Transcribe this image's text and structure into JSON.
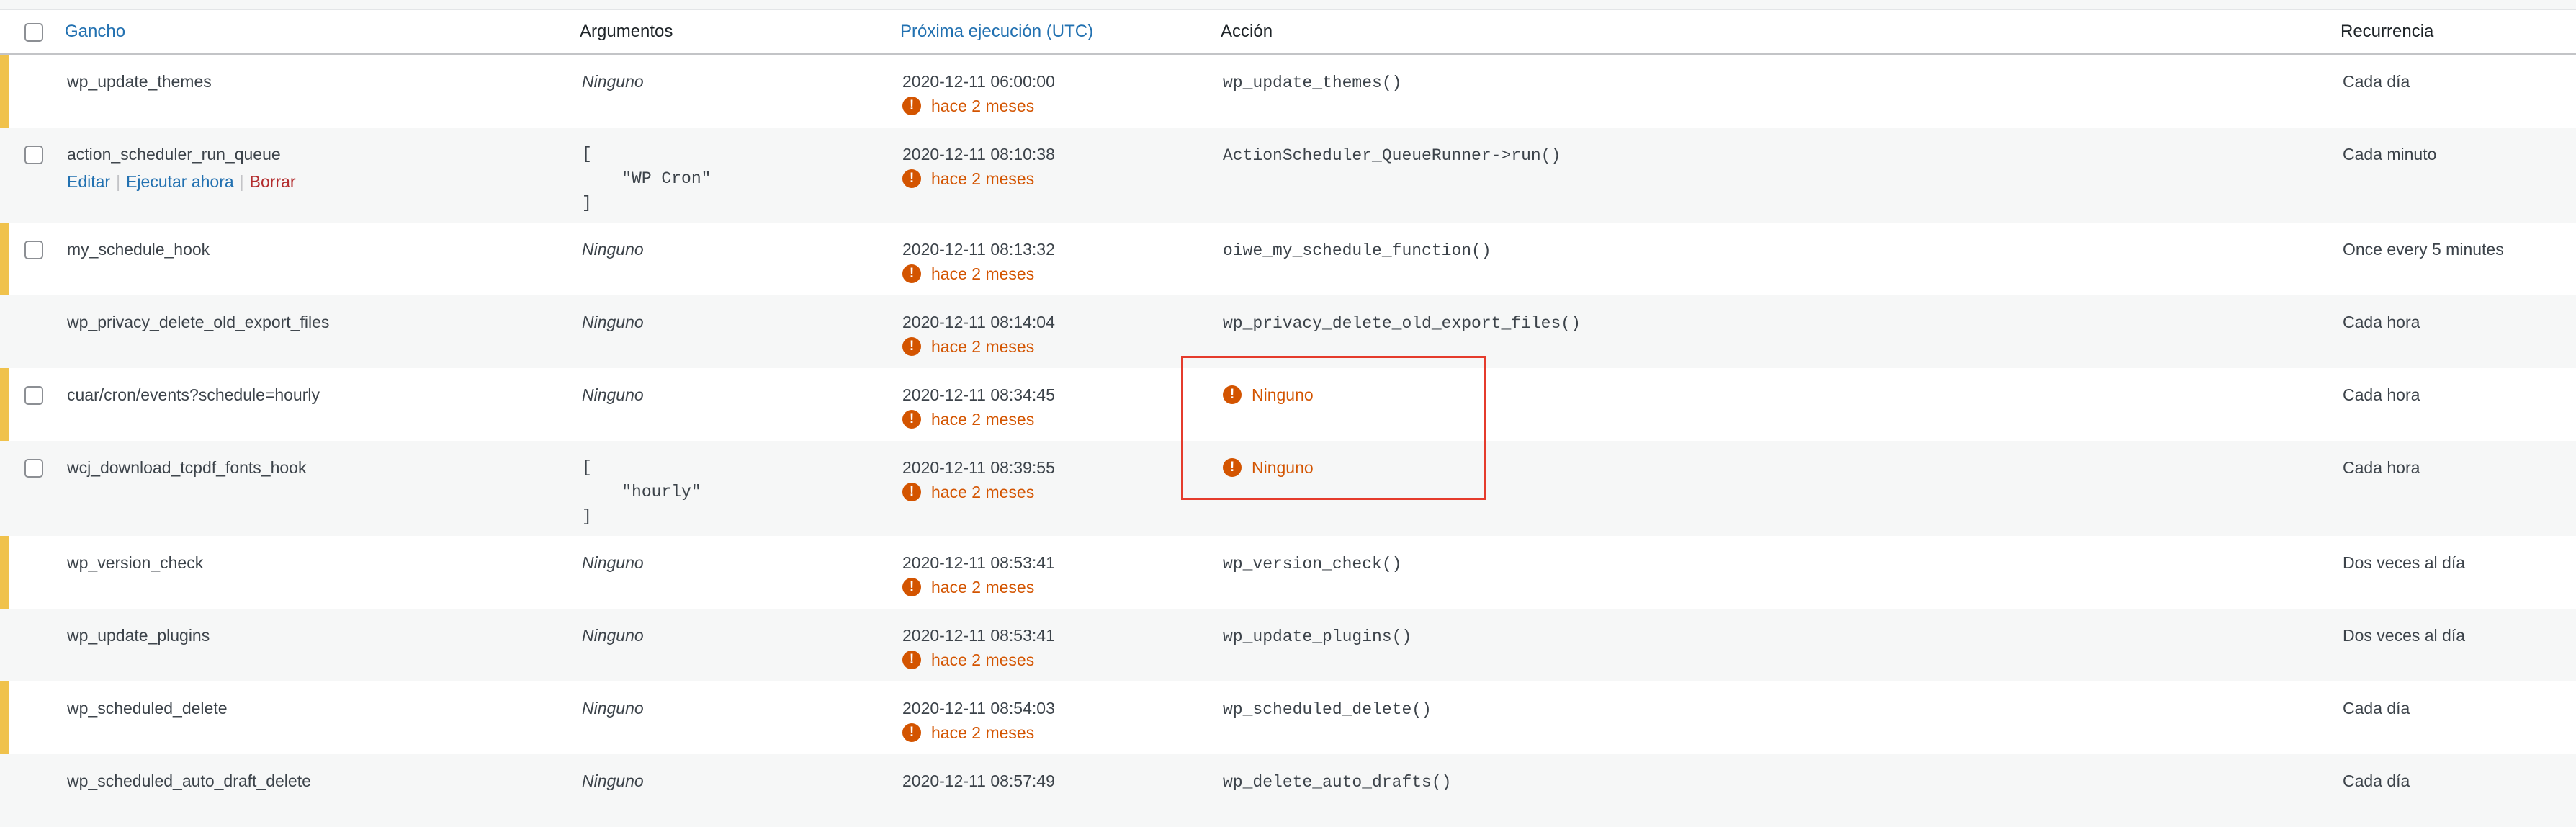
{
  "table": {
    "headers": {
      "hook": "Gancho",
      "arguments": "Argumentos",
      "next_run": "Próxima ejecución (UTC)",
      "action": "Acción",
      "recurrence": "Recurrencia"
    },
    "row_actions": {
      "edit": "Editar",
      "run_now": "Ejecutar ahora",
      "delete": "Borrar"
    },
    "warning_text": "hace 2 meses",
    "none_text": "Ninguno",
    "rows": [
      {
        "hook": "wp_update_themes",
        "args": "Ninguno",
        "next": "2020-12-11 06:00:00",
        "action": "wp_update_themes()",
        "recurrence": "Cada día"
      },
      {
        "hook": "action_scheduler_run_queue",
        "args": "[\n    \"WP Cron\"\n]",
        "next": "2020-12-11 08:10:38",
        "action": "ActionScheduler_QueueRunner->run()",
        "recurrence": "Cada minuto"
      },
      {
        "hook": "my_schedule_hook",
        "args": "Ninguno",
        "next": "2020-12-11 08:13:32",
        "action": "oiwe_my_schedule_function()",
        "recurrence": "Once every 5 minutes"
      },
      {
        "hook": "wp_privacy_delete_old_export_files",
        "args": "Ninguno",
        "next": "2020-12-11 08:14:04",
        "action": "wp_privacy_delete_old_export_files()",
        "recurrence": "Cada hora"
      },
      {
        "hook": "cuar/cron/events?schedule=hourly",
        "args": "Ninguno",
        "next": "2020-12-11 08:34:45",
        "action": "Ninguno",
        "recurrence": "Cada hora"
      },
      {
        "hook": "wcj_download_tcpdf_fonts_hook",
        "args": "[\n    \"hourly\"\n]",
        "next": "2020-12-11 08:39:55",
        "action": "Ninguno",
        "recurrence": "Cada hora"
      },
      {
        "hook": "wp_version_check",
        "args": "Ninguno",
        "next": "2020-12-11 08:53:41",
        "action": "wp_version_check()",
        "recurrence": "Dos veces al día"
      },
      {
        "hook": "wp_update_plugins",
        "args": "Ninguno",
        "next": "2020-12-11 08:53:41",
        "action": "wp_update_plugins()",
        "recurrence": "Dos veces al día"
      },
      {
        "hook": "wp_scheduled_delete",
        "args": "Ninguno",
        "next": "2020-12-11 08:54:03",
        "action": "wp_scheduled_delete()",
        "recurrence": "Cada día"
      },
      {
        "hook": "wp_scheduled_auto_draft_delete",
        "args": "Ninguno",
        "next": "2020-12-11 08:57:49",
        "action": "wp_delete_auto_drafts()",
        "recurrence": "Cada día"
      }
    ]
  },
  "colors": {
    "link": "#2271b1",
    "warning": "#d35400",
    "delete": "#b32d2e",
    "highlight": "#e53b2c",
    "left_bar": "#f0c24c"
  },
  "icons": {
    "warning": "exclamation-circle-icon"
  }
}
